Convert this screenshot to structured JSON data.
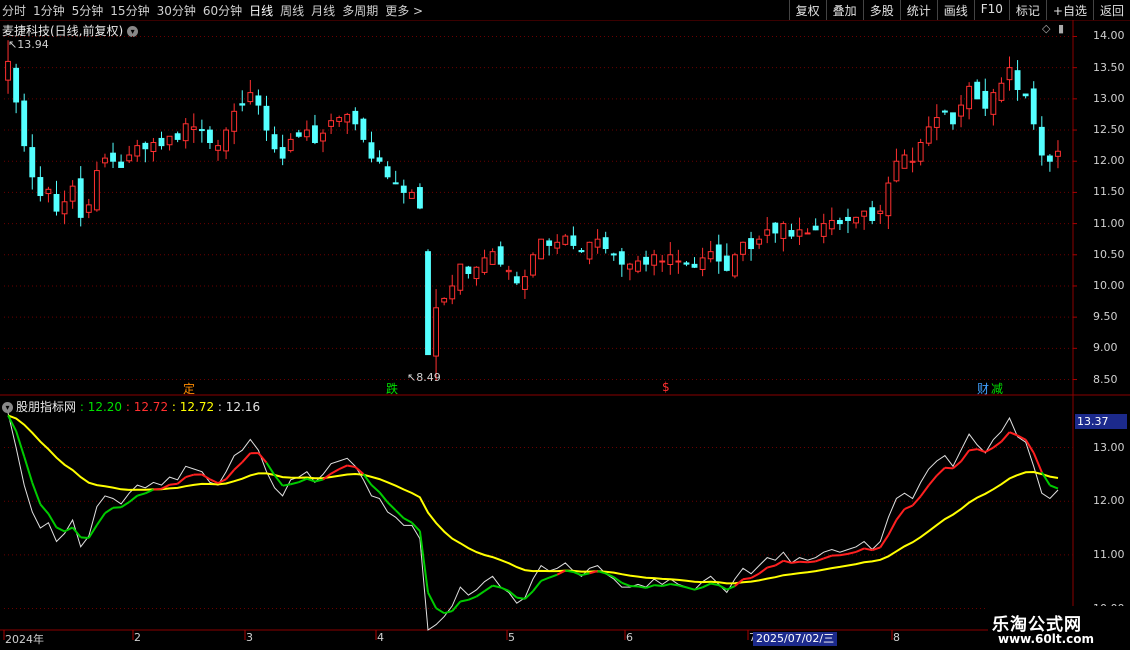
{
  "toolbar": {
    "periods": [
      "分时",
      "1分钟",
      "5分钟",
      "15分钟",
      "30分钟",
      "60分钟",
      "日线",
      "周线",
      "月线",
      "多周期",
      "更多 >"
    ],
    "active_period": "日线",
    "actions": [
      "复权",
      "叠加",
      "多股",
      "统计",
      "画线",
      "F10",
      "标记",
      "+自选",
      "返回"
    ]
  },
  "stock": {
    "title": "麦捷科技(日线,前复权)",
    "high_label": "13.94",
    "low_label": "8.49"
  },
  "price_axis": [
    "14.00",
    "13.50",
    "13.00",
    "12.50",
    "12.00",
    "11.50",
    "11.00",
    "10.50",
    "10.00",
    "9.50",
    "9.00",
    "8.50"
  ],
  "indicator": {
    "name": "股朋指标网",
    "values": [
      {
        "text": "12.20",
        "color": "#00e000"
      },
      {
        "text": "12.72",
        "color": "#ff3030"
      },
      {
        "text": "12.72",
        "color": "#ffff00"
      },
      {
        "text": "12.16",
        "color": "#e0e0e0"
      }
    ],
    "axis": [
      "13.00",
      "12.00",
      "11.00",
      "10.00"
    ],
    "current": "13.37"
  },
  "time_axis": [
    "2024年",
    "2",
    "3",
    "4",
    "5",
    "6",
    "7",
    "8"
  ],
  "cursor_date": "2025/07/02/三",
  "event_markers": [
    {
      "text": "定",
      "color": "#ff8c00"
    },
    {
      "text": "跌",
      "color": "#00e000"
    },
    {
      "text": "$",
      "color": "#ff3030"
    },
    {
      "text": "财",
      "color": "#40a0ff"
    },
    {
      "text": "减",
      "color": "#00e000"
    }
  ],
  "watermark": {
    "line1": "乐淘公式网",
    "line2": "www.60lt.com"
  },
  "colors": {
    "up": "#ff3030",
    "down": "#54ffff",
    "ma_fast": "#ff2020",
    "ma_mid": "#00cc00",
    "ma_slow": "#ffff00",
    "grid": "#6a0000"
  },
  "chart_data": {
    "type": "candlestick",
    "price_range": [
      8.3,
      14.2
    ],
    "high": 13.94,
    "low": 8.49,
    "closes": [
      13.6,
      12.95,
      12.25,
      11.75,
      11.45,
      11.55,
      11.2,
      11.35,
      11.6,
      11.1,
      11.3,
      11.85,
      12.05,
      12.0,
      11.9,
      12.1,
      12.25,
      12.2,
      12.3,
      12.25,
      12.4,
      12.35,
      12.6,
      12.55,
      12.5,
      12.3,
      12.25,
      12.5,
      12.8,
      12.9,
      13.1,
      12.9,
      12.5,
      12.2,
      12.05,
      12.35,
      12.4,
      12.5,
      12.3,
      12.45,
      12.65,
      12.7,
      12.75,
      12.6,
      12.35,
      12.05,
      12.0,
      11.75,
      11.65,
      11.5,
      11.5,
      11.25,
      8.9,
      9.65,
      9.8,
      10.0,
      10.35,
      10.2,
      10.3,
      10.45,
      10.55,
      10.35,
      10.25,
      10.05,
      10.15,
      10.5,
      10.75,
      10.65,
      10.7,
      10.8,
      10.65,
      10.55,
      10.7,
      10.75,
      10.6,
      10.5,
      10.35,
      10.35,
      10.4,
      10.35,
      10.5,
      10.4,
      10.5,
      10.4,
      10.35,
      10.3,
      10.45,
      10.55,
      10.4,
      10.25,
      10.5,
      10.7,
      10.6,
      10.75,
      10.9,
      10.85,
      11.0,
      10.8,
      10.9,
      10.85,
      10.9,
      11.0,
      11.05,
      11.0,
      11.05,
      11.1,
      11.2,
      11.05,
      11.2,
      11.65,
      12.0,
      12.1,
      12.0,
      12.3,
      12.55,
      12.7,
      12.8,
      12.6,
      12.9,
      13.2,
      13.0,
      12.85,
      13.1,
      13.25,
      13.5,
      13.15,
      13.05,
      12.6,
      12.1,
      12.0,
      12.16
    ]
  }
}
